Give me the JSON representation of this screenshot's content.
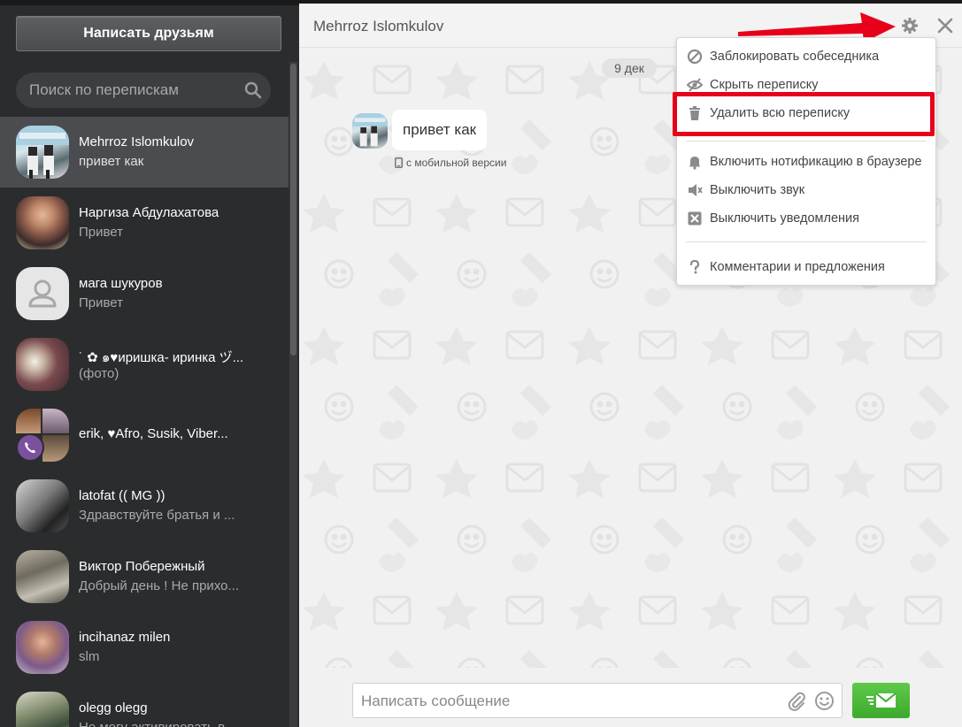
{
  "sidebar": {
    "write_button": "Написать друзьям",
    "search_placeholder": "Поиск по перепискам",
    "conversations": [
      {
        "name": "Mehrroz Islomkulov",
        "preview": "привет как"
      },
      {
        "name": "Наргиза Абдулахатова",
        "preview": "Привет"
      },
      {
        "name": "мага шукуров",
        "preview": "Привет"
      },
      {
        "name": "˙ ✿ ๑♥иришка- иринка ヅ...",
        "preview": "(фото)"
      },
      {
        "name": "erik, ♥Afro, Susik, Viber...",
        "preview": ""
      },
      {
        "name": "latofat (( MG ))",
        "preview": "Здравствуйте братья и ..."
      },
      {
        "name": "Виктор Побережный",
        "preview": "Добрый день ! Не прихо..."
      },
      {
        "name": "incihanaz milen",
        "preview": "slm"
      },
      {
        "name": "olegg olegg",
        "preview": "Не могу активировать в..."
      }
    ]
  },
  "chat": {
    "title": "Mehrroz Islomkulov",
    "date_label": "9 дек",
    "message_text": "привет как",
    "message_meta": "с мобильной версии",
    "composer_placeholder": "Написать сообщение"
  },
  "menu": {
    "items": [
      {
        "label": "Заблокировать собеседника",
        "icon": "block-icon"
      },
      {
        "label": "Скрыть переписку",
        "icon": "eye-off-icon"
      },
      {
        "label": "Удалить всю переписку",
        "icon": "trash-icon"
      },
      {
        "label": "Включить нотификацию в браузере",
        "icon": "bell-icon"
      },
      {
        "label": "Выключить звук",
        "icon": "mute-icon"
      },
      {
        "label": "Выключить уведомления",
        "icon": "notifications-off-icon"
      },
      {
        "label": "Комментарии и предложения",
        "icon": "question-icon"
      }
    ]
  },
  "colors": {
    "sidebar_bg": "#2b2c2e",
    "active_item": "#4b4c4f",
    "send_green": "#45b034",
    "highlight_red": "#e8001a"
  }
}
